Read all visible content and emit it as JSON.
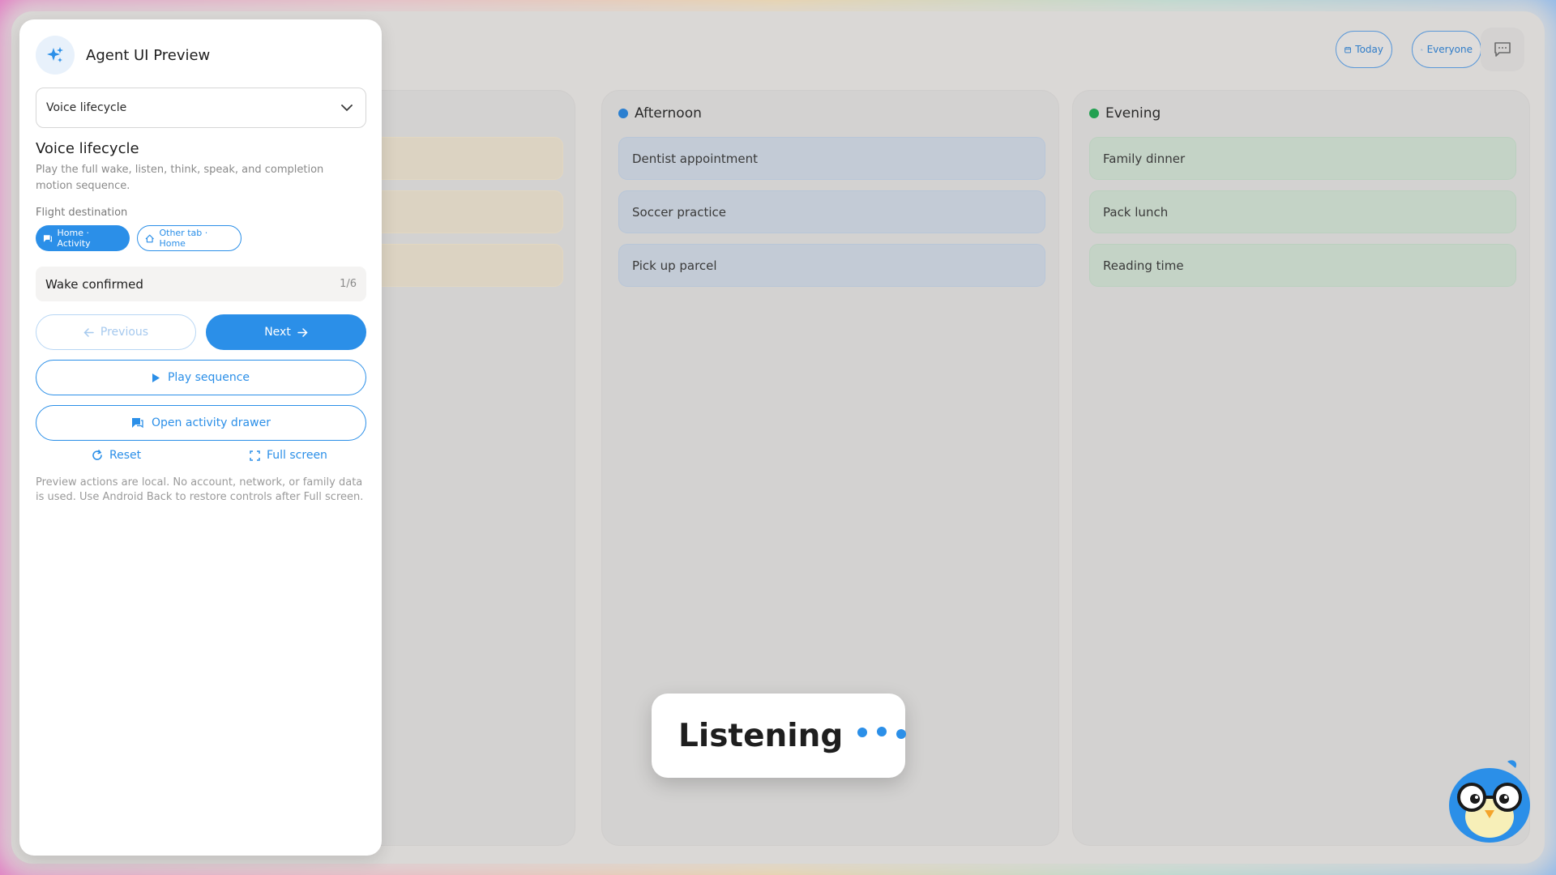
{
  "toolbar": {
    "today_label": "Today",
    "everyone_label": "Everyone"
  },
  "columns": {
    "afternoon": {
      "title": "Afternoon",
      "color": "#2b7fd0",
      "items": [
        "Dentist appointment",
        "Soccer practice",
        "Pick up parcel"
      ]
    },
    "evening": {
      "title": "Evening",
      "color": "#22a051",
      "items": [
        "Family dinner",
        "Pack lunch",
        "Reading time"
      ]
    }
  },
  "listening": {
    "label": "Listening"
  },
  "panel": {
    "title": "Agent UI Preview",
    "select_value": "Voice lifecycle",
    "section_title": "Voice lifecycle",
    "section_desc": "Play the full wake, listen, think, speak, and completion motion sequence.",
    "destination_label": "Flight destination",
    "chips": {
      "active": "Home · Activity",
      "other": "Other tab · Home"
    },
    "status": {
      "label": "Wake confirmed",
      "count": "1/6"
    },
    "buttons": {
      "previous": "Previous",
      "next": "Next",
      "play": "Play sequence",
      "drawer": "Open activity drawer",
      "reset": "Reset",
      "fullscreen": "Full screen"
    },
    "footnote": "Preview actions are local. No account, network, or family data is used. Use Android Back to restore controls after Full screen."
  },
  "colors": {
    "accent": "#2b8fe8",
    "afternoon_dot": "#2b7fd0",
    "evening_dot": "#22a051"
  }
}
